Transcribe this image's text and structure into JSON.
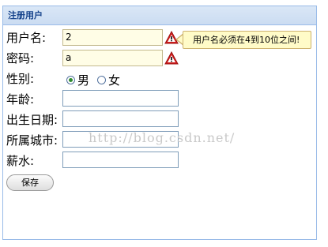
{
  "panel": {
    "title": "注册用户"
  },
  "form": {
    "username": {
      "label": "用户名:",
      "value": "2",
      "error": "用户名必须在4到10位之间!"
    },
    "password": {
      "label": "密码:",
      "value": "a"
    },
    "gender": {
      "label": "性别:",
      "options": [
        "男",
        "女"
      ],
      "selected": "男"
    },
    "age": {
      "label": "年龄:",
      "value": ""
    },
    "birthdate": {
      "label": "出生日期:",
      "value": ""
    },
    "city": {
      "label": "所属城市:",
      "value": ""
    },
    "salary": {
      "label": "薪水:",
      "value": ""
    },
    "save_label": "保存"
  },
  "watermark": "http://blog.csdn.net/",
  "colors": {
    "header_text": "#15428b",
    "panel_border": "#99bbe8",
    "invalid_background": "#fffde6",
    "tooltip_background": "#fffbc8",
    "warning_red": "#d21f1f"
  },
  "icons": {
    "warning": "warning-icon"
  }
}
